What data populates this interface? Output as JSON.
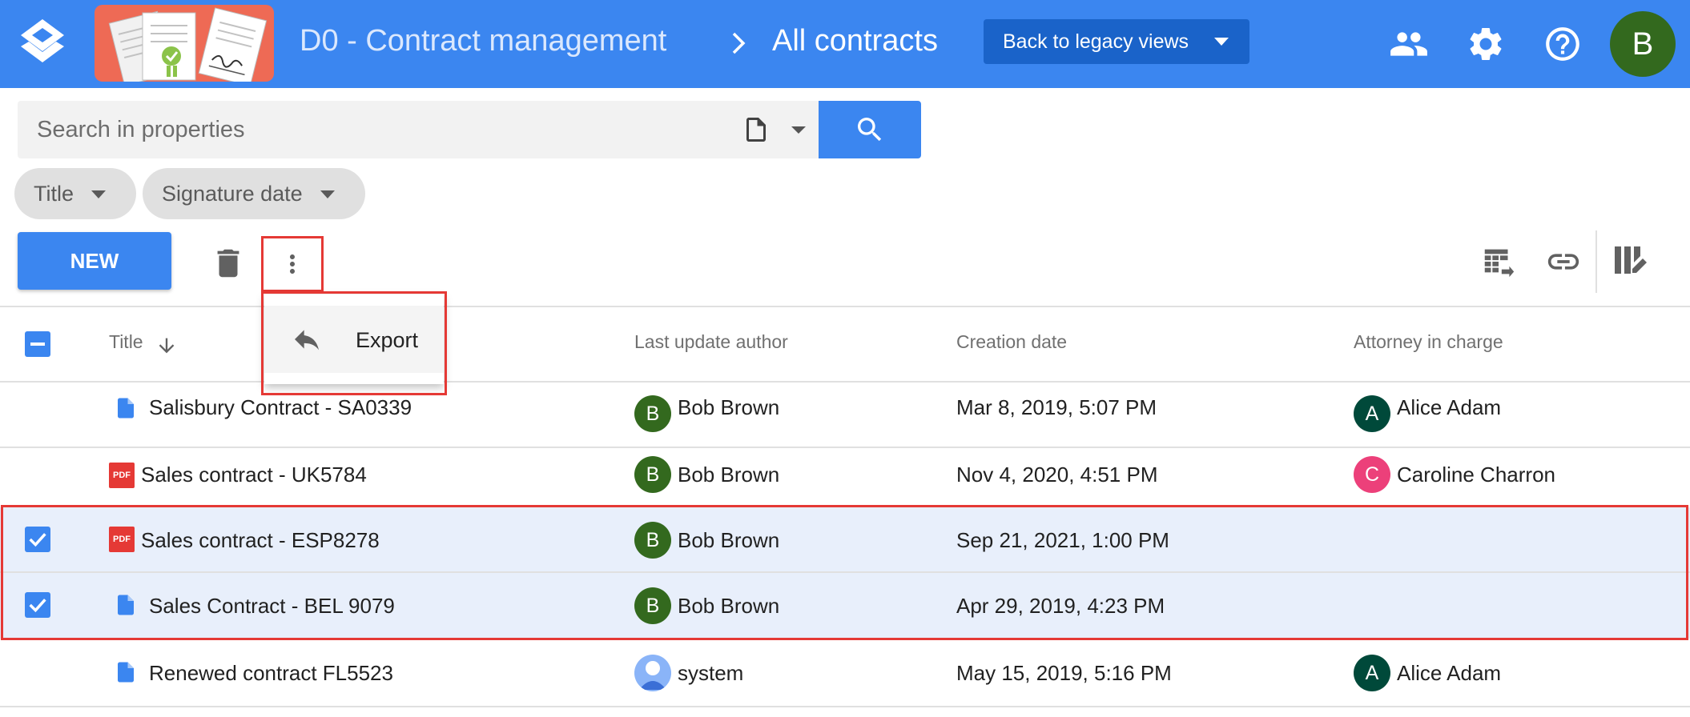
{
  "header": {
    "app_title": "D0 - Contract management",
    "page_title": "All contracts",
    "legacy_button": "Back to legacy views",
    "user_initial": "B",
    "colors": {
      "bar": "#3b86f0",
      "button": "#1a63c9",
      "avatar": "#33691e"
    }
  },
  "search": {
    "placeholder": "Search in properties"
  },
  "filters": [
    {
      "label": "Title"
    },
    {
      "label": "Signature date"
    }
  ],
  "actions": {
    "new_label": "NEW",
    "menu": {
      "export_label": "Export"
    }
  },
  "table": {
    "columns": {
      "title": "Title",
      "author": "Last update author",
      "created": "Creation date",
      "attorney": "Attorney in charge"
    },
    "rows": [
      {
        "title": "Salisbury Contract - SA0339",
        "type": "doc",
        "author": "Bob Brown",
        "author_initial": "B",
        "created": "Mar 8, 2019, 5:07 PM",
        "attorney": "Alice Adam",
        "attorney_initial": "A",
        "selected": false
      },
      {
        "title": "Sales contract - UK5784",
        "type": "pdf",
        "author": "Bob Brown",
        "author_initial": "B",
        "created": "Nov 4, 2020, 4:51 PM",
        "attorney": "Caroline Charron",
        "attorney_initial": "C",
        "selected": false
      },
      {
        "title": "Sales contract - ESP8278",
        "type": "pdf",
        "author": "Bob Brown",
        "author_initial": "B",
        "created": "Sep 21, 2021, 1:00 PM",
        "attorney": "",
        "selected": true
      },
      {
        "title": "Sales Contract - BEL 9079",
        "type": "doc",
        "author": "Bob Brown",
        "author_initial": "B",
        "created": "Apr 29, 2019, 4:23 PM",
        "attorney": "",
        "selected": true
      },
      {
        "title": "Renewed contract FL5523",
        "type": "doc",
        "author": "system",
        "created": "May 15, 2019, 5:16 PM",
        "attorney": "Alice Adam",
        "attorney_initial": "A",
        "selected": false
      }
    ],
    "pdf_badge": "PDF",
    "colors": {
      "selected_row": "#e8effb",
      "bob": "#33691e",
      "alice": "#00493a",
      "caroline": "#ec407a",
      "highlight": "#e53935"
    }
  }
}
